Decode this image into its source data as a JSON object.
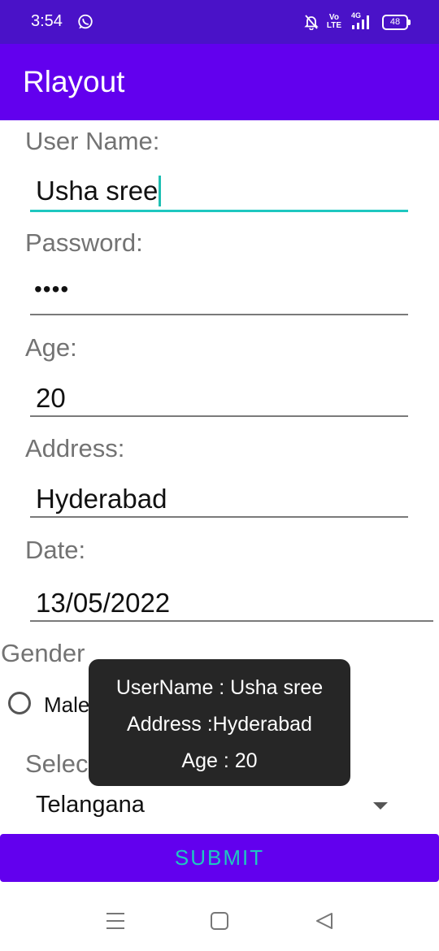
{
  "status_bar": {
    "time": "3:54",
    "volte_top": "Vo",
    "volte_bottom": "LTE",
    "network": "4G",
    "battery": "48",
    "icons": [
      "whatsapp-icon",
      "muted-bell-icon",
      "volte-icon",
      "signal-icon",
      "battery-icon"
    ]
  },
  "app_bar": {
    "title": "Rlayout"
  },
  "form": {
    "username_label": "User Name:",
    "username_value": "Usha sree",
    "password_label": "Password:",
    "password_value": "••••",
    "age_label": "Age:",
    "age_value": "20",
    "address_label": "Address:",
    "address_value": "Hyderabad",
    "date_label": "Date:",
    "date_value": "13/05/2022",
    "gender_label": "Gender",
    "gender_option_male": "Male",
    "state_label": "Selec",
    "state_value": "Telangana",
    "submit_label": "SUBMIT"
  },
  "toast": {
    "line1": "UserName : Usha sree",
    "line2": "Address :Hyderabad",
    "line3": "Age : 20"
  },
  "nav_bar": {
    "icons": [
      "menu-icon",
      "home-icon",
      "back-icon"
    ]
  },
  "colors": {
    "status_bar": "#4a12c8",
    "primary": "#6200ee",
    "accent": "#1fc7c0",
    "toast": "#262626"
  }
}
